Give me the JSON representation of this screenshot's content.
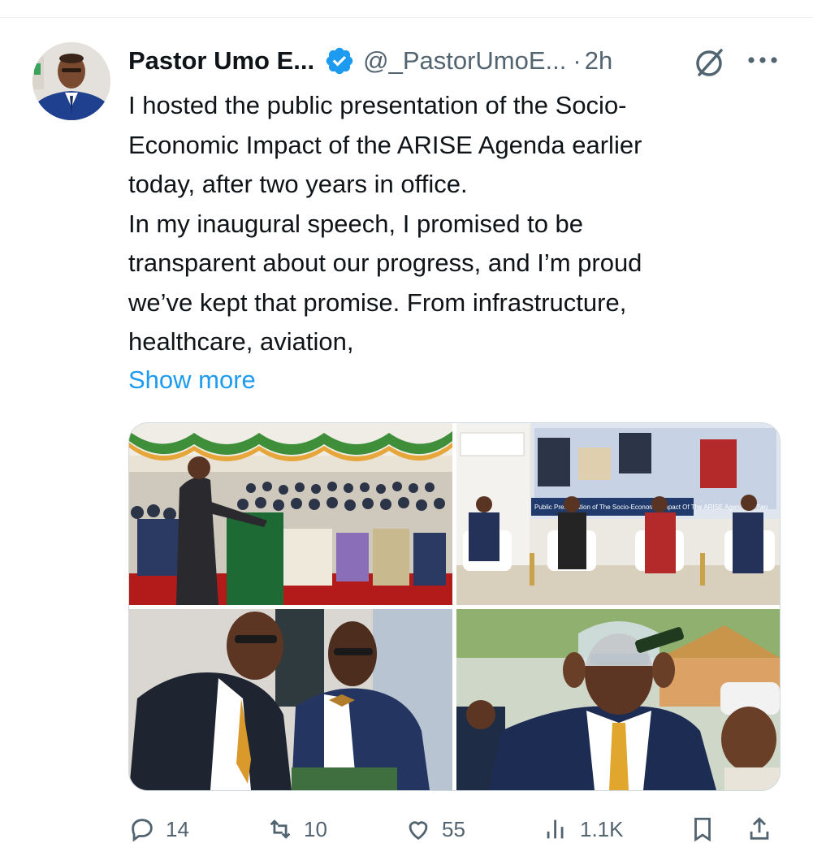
{
  "tweet": {
    "author_name": "Pastor Umo E...",
    "handle": "@_PastorUmoE...",
    "separator": "·",
    "time": "2h",
    "verified": true,
    "text_lines": [
      "I hosted the public presentation of the Socio-",
      "Economic Impact of the ARISE Agenda earlier",
      "today, after two years in office.",
      "In my inaugural speech, I promised to be",
      "transparent about our progress, and I’m proud",
      "we’ve kept that promise. From infrastructure,",
      "healthcare, aviation,"
    ],
    "show_more_label": "Show more"
  },
  "media": {
    "photo2_screen_text": "Public Presentation of The Socio-Economic Impact Of The ARISE Agenda In Two"
  },
  "actions": {
    "replies": "14",
    "reposts": "10",
    "likes": "55",
    "views": "1.1K"
  },
  "colors": {
    "accent": "#1d9bf0",
    "text_primary": "#0f1419",
    "text_secondary": "#536471",
    "border": "#cfd9de"
  },
  "icons": [
    "verified-badge-icon",
    "grok-icon",
    "more-icon",
    "reply-icon",
    "repost-icon",
    "like-icon",
    "views-icon",
    "bookmark-icon",
    "share-icon"
  ]
}
